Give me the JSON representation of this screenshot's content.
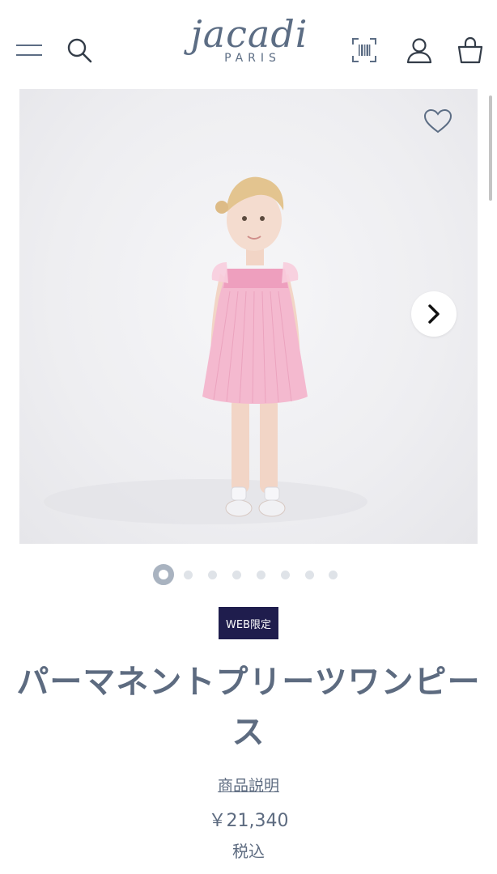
{
  "header": {
    "brand_main": "jacadi",
    "brand_sub": "PARIS",
    "icons": [
      "menu-icon",
      "search-icon",
      "barcode-scan-icon",
      "account-icon",
      "shopping-bag-icon"
    ]
  },
  "gallery": {
    "image_alt": "Girl wearing pink pleated dress",
    "wishlist_icon": "heart-icon",
    "next_icon": "chevron-right-icon",
    "current_slide": 1,
    "slide_count": 8
  },
  "product": {
    "badge": "WEB限定",
    "title": "パーマネントプリーツワンピース",
    "description_link": "商品説明",
    "price": "￥21,340",
    "tax_note": "税込"
  },
  "colors": {
    "brand": "#5c6d84",
    "badge_bg": "#1f1d4d",
    "dress": "#f4b9cf"
  }
}
